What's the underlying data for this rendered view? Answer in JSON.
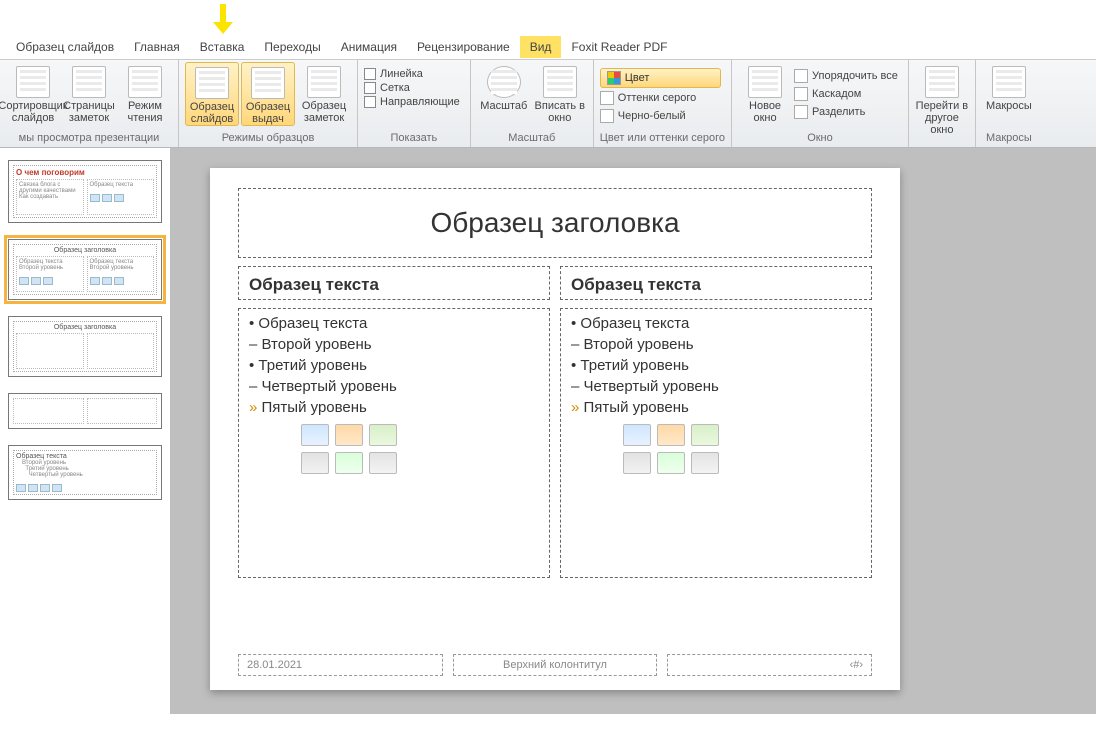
{
  "tabs": {
    "slide_master": "Образец слайдов",
    "home": "Главная",
    "insert": "Вставка",
    "transitions": "Переходы",
    "animation": "Анимация",
    "review": "Рецензирование",
    "view": "Вид",
    "foxit": "Foxit Reader PDF"
  },
  "ribbon": {
    "g1": {
      "sort": "Сортировщик слайдов",
      "notes": "Страницы заметок",
      "reading": "Режим чтения",
      "label": "мы просмотра презентации"
    },
    "g2": {
      "slide_master": "Образец слайдов",
      "handout_master": "Образец выдач",
      "notes_master": "Образец заметок",
      "label": "Режимы образцов"
    },
    "g3": {
      "ruler": "Линейка",
      "grid": "Сетка",
      "guides": "Направляющие",
      "label": "Показать"
    },
    "g4": {
      "zoom": "Масштаб",
      "fit": "Вписать в окно",
      "label": "Масштаб"
    },
    "g5": {
      "color": "Цвет",
      "gray": "Оттенки серого",
      "bw": "Черно-белый",
      "label": "Цвет или оттенки серого"
    },
    "g6": {
      "new_window": "Новое окно",
      "arrange": "Упорядочить все",
      "cascade": "Каскадом",
      "split": "Разделить",
      "label": "Окно"
    },
    "g7": {
      "switch": "Перейти в другое окно",
      "macros": "Макросы",
      "label_macros": "Макросы"
    }
  },
  "thumbs": {
    "t1_title": "О чем поговорим",
    "t1_line1": "Связка блога с другими качествами",
    "t1_line2": "Как создавать",
    "t2_title": "Образец заголовка",
    "col_text": "Образец текста",
    "lvl2": "Второй уровень",
    "lvl3": "Третий уровень",
    "lvl4": "Четвертый уровень"
  },
  "slide": {
    "title": "Образец заголовка",
    "col_head": "Образец текста",
    "l1": "Образец текста",
    "l2": "Второй уровень",
    "l3": "Третий уровень",
    "l4": "Четвертый уровень",
    "l5": "Пятый уровень",
    "date": "28.01.2021",
    "footer": "Верхний колонтитул",
    "pagenum": "‹#›"
  }
}
